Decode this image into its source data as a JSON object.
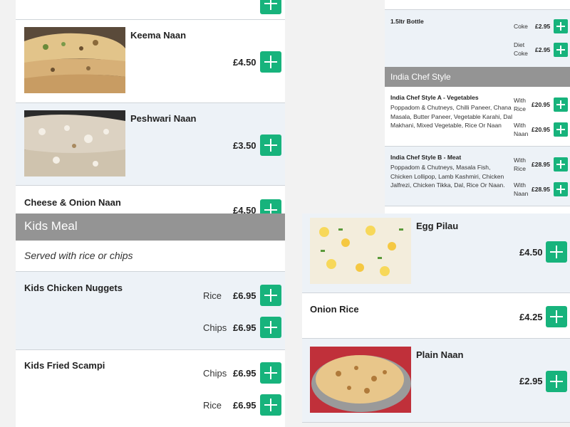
{
  "breads": {
    "keema": {
      "name": "Keema Naan",
      "price": "£4.50"
    },
    "peshwari": {
      "name": "Peshwari Naan",
      "price": "£3.50"
    },
    "cheese_onion": {
      "name": "Cheese & Onion Naan",
      "price": "£4.50"
    }
  },
  "soft_drinks": {
    "bottle": {
      "name": "1.5ltr Bottle",
      "options": [
        {
          "label": "Coke",
          "price": "£2.95"
        },
        {
          "label": "Diet Coke",
          "price": "£2.95"
        }
      ]
    }
  },
  "india_chef_style": {
    "title": "India Chef Style",
    "items": [
      {
        "name": "India Chef Style A - Vegetables",
        "description": "Poppadom & Chutneys, Chilli Paneer, Chana Masala, Butter Paneer, Vegetable Karahi, Dal Makhani, Mixed Vegetable, Rice Or Naan",
        "options": [
          {
            "label": "With Rice",
            "price": "£20.95"
          },
          {
            "label": "With Naan",
            "price": "£20.95"
          }
        ]
      },
      {
        "name": "India Chef Style B - Meat",
        "description": "Poppadom & Chutneys, Masala Fish, Chicken Lollipop, Lamb Kashmiri, Chicken Jalfrezi, Chicken Tikka, Dal, Rice Or Naan.",
        "options": [
          {
            "label": "With Rice",
            "price": "£28.95"
          },
          {
            "label": "With Naan",
            "price": "£28.95"
          }
        ]
      }
    ]
  },
  "kids_meal": {
    "title": "Kids Meal",
    "subtitle": "Served with rice or chips",
    "items": [
      {
        "name": "Kids Chicken Nuggets",
        "options": [
          {
            "label": "Rice",
            "price": "£6.95"
          },
          {
            "label": "Chips",
            "price": "£6.95"
          }
        ]
      },
      {
        "name": "Kids Fried Scampi",
        "options": [
          {
            "label": "Chips",
            "price": "£6.95"
          },
          {
            "label": "Rice",
            "price": "£6.95"
          }
        ]
      }
    ]
  },
  "rice_breads": {
    "egg_pilau": {
      "name": "Egg Pilau",
      "price": "£4.50"
    },
    "onion_rice": {
      "name": "Onion Rice",
      "price": "£4.25"
    },
    "plain_naan": {
      "name": "Plain Naan",
      "price": "£2.95"
    }
  },
  "colors": {
    "add_button": "#17b37c",
    "section_header": "#949494",
    "card_alt": "#edf2f7"
  },
  "icons": {
    "add": "plus-icon"
  }
}
